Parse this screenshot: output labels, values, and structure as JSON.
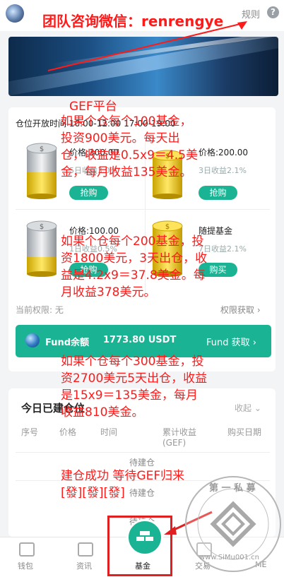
{
  "header": {
    "rules_label": "规则",
    "help_glyph": "?"
  },
  "card1": {
    "hours": "仓位开放时间 10:00-12:00 17:00-19:00",
    "products": [
      {
        "price": "价格:300.00",
        "earn": "5日收益3.0%",
        "button": "抢购"
      },
      {
        "price": "价格:200.00",
        "earn": "3日收益2.1%",
        "button": "抢购"
      },
      {
        "price": "价格:100.00",
        "earn": "1日收益0.5%",
        "button": "抢购"
      },
      {
        "name": "随提基金",
        "earn": "7日收益2.1%",
        "button": "购买"
      }
    ],
    "permission": "当前权限: 无",
    "permission_get": "权限获取",
    "fund_label": "Fund余额",
    "fund_amount": "1773.80 USDT",
    "fund_get": "Fund 获取"
  },
  "card2": {
    "title": "今日已建仓位",
    "collapse": "收起",
    "columns": [
      "序号",
      "价格",
      "时间",
      "累计收益(GEF)",
      "购买日期"
    ],
    "pending": [
      "待建仓",
      "待建仓",
      "待建仓"
    ]
  },
  "tabs": [
    {
      "label": "钱包",
      "icon": "wallet-icon"
    },
    {
      "label": "资讯",
      "icon": "news-icon"
    },
    {
      "label": "基金",
      "icon": "fund-icon"
    },
    {
      "label": "交易",
      "icon": "trade-icon"
    },
    {
      "label": "ME",
      "icon": "me-icon"
    }
  ],
  "overlay": {
    "team": "团队咨询微信：renrengye",
    "platform": "GEF平台",
    "note1": "如果个仓每个100基金，投资900美元。每天出仓，收益是0.5x9＝4.5美金，每月收益135美金。",
    "note2": "如果个仓每个200基金，投资1800美元，3天出仓，收益是4.2x9＝37.8美金。每月收益378美元。",
    "note3": "如果个仓每个300基金，投资2700美元5天出仓，收益是15x9＝135美金，每月收益810美金。",
    "note4": "建仓成功 等待GEF归来[發][發][發]",
    "watermark_top": "第 一 私 募",
    "watermark_bottom": "www.SiMu001.cn"
  },
  "colors": {
    "accent": "#1ab394",
    "annotation": "#ff1a1a"
  }
}
